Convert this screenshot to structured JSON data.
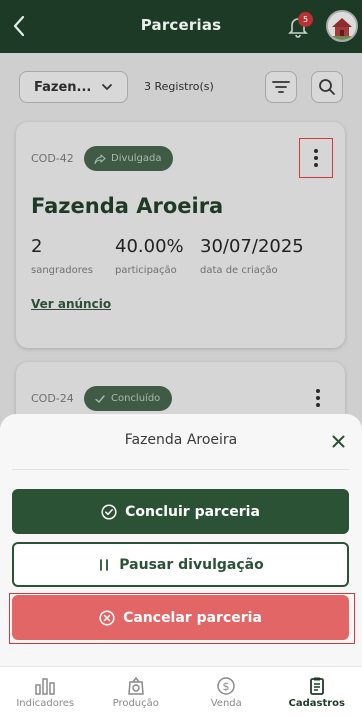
{
  "header": {
    "title": "Parcerias",
    "notification_count": "5"
  },
  "filters": {
    "farm_select_value": "Fazen...",
    "records_count": "3 Registro(s)"
  },
  "cards": [
    {
      "code": "COD-42",
      "status": "Divulgada",
      "farm_name": "Fazenda Aroeira",
      "stats": [
        {
          "value": "2",
          "label": "sangradores"
        },
        {
          "value": "40.00%",
          "label": "participação"
        },
        {
          "value": "30/07/2025",
          "label": "data de criação"
        }
      ],
      "link": "Ver anúncio"
    },
    {
      "code": "COD-24",
      "status": "Concluído"
    }
  ],
  "sheet": {
    "title": "Fazenda Aroeira",
    "actions": {
      "conclude": "Concluir parceria",
      "pause": "Pausar divulgação",
      "cancel": "Cancelar parceria"
    }
  },
  "nav": {
    "items": [
      {
        "label": "Indicadores",
        "icon": "bar-chart-icon"
      },
      {
        "label": "Produção",
        "icon": "production-icon"
      },
      {
        "label": "Venda",
        "icon": "dollar-icon"
      },
      {
        "label": "Cadastros",
        "icon": "clipboard-icon"
      }
    ]
  },
  "colors": {
    "header_bg": "#1d3a27",
    "primary_green": "#2b5235",
    "danger": "#e36666",
    "highlight_red": "#d23a3a"
  }
}
